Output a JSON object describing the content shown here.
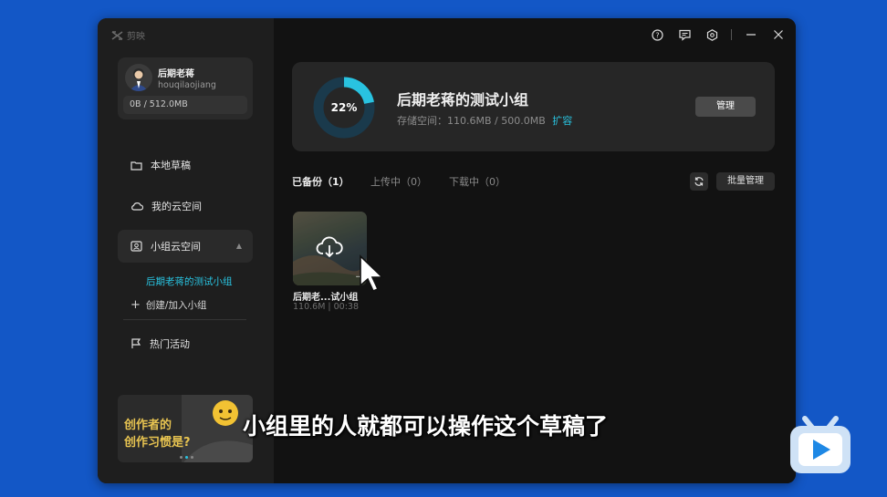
{
  "app": {
    "name": "剪映"
  },
  "user": {
    "name": "后期老蒋",
    "id": "houqilaojiang",
    "quota": "0B / 512.0MB"
  },
  "nav": {
    "local_drafts": "本地草稿",
    "my_cloud": "我的云空间",
    "group_cloud": "小组云空间",
    "group_selected": "后期老蒋的测试小组",
    "create_join": "创建/加入小组",
    "hot_events": "热门活动"
  },
  "banner": {
    "line1": "创作者的",
    "line2": "创作习惯是?"
  },
  "storage": {
    "percent": 22,
    "percent_label": "22%",
    "title": "后期老蒋的测试小组",
    "usage_label": "存储空间：110.6MB / 500.0MB",
    "expand": "扩容",
    "manage": "管理"
  },
  "tabs": [
    "已备份（1）",
    "上传中（0）",
    "下载中（0）"
  ],
  "toolbar": {
    "batch_manage": "批量管理"
  },
  "drafts": [
    {
      "name": "后期老...试小组",
      "meta": "110.6M | 00:38"
    }
  ],
  "subtitle": "小组里的人就都可以操作这个草稿了",
  "colors": {
    "accent": "#29c3e0",
    "background": "#1357c6",
    "window": "#141414",
    "sidebar": "#1e1e1e"
  }
}
